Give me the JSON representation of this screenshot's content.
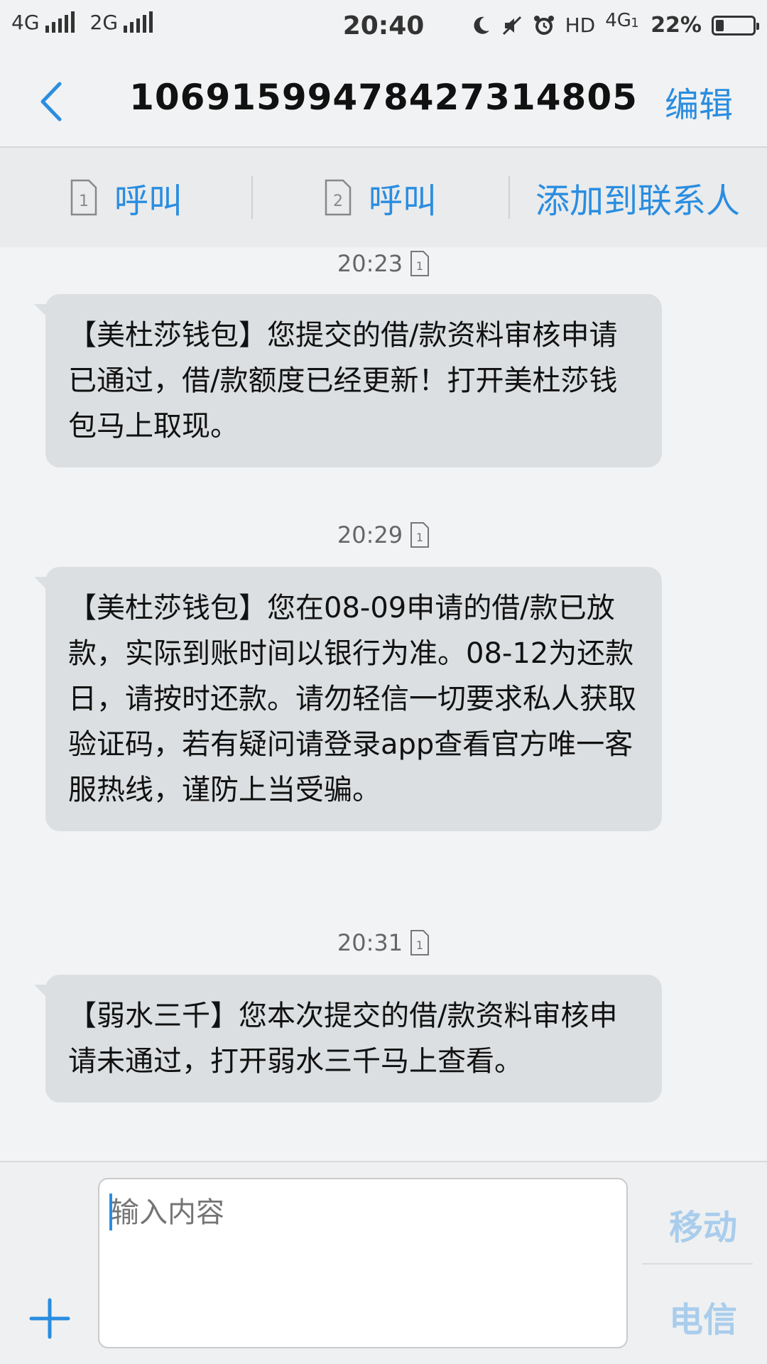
{
  "status_bar": {
    "network_1": "4G",
    "network_2": "2G",
    "time": "20:40",
    "hd_label": "HD",
    "net_type": "4G",
    "sim_index": "1",
    "battery_percent": "22%",
    "battery_level": 0.22
  },
  "header": {
    "title": "1069159947842731480​5",
    "edit_label": "编辑"
  },
  "actions": {
    "call_sim1_number": "1",
    "call_sim1_label": "呼叫",
    "call_sim2_number": "2",
    "call_sim2_label": "呼叫",
    "add_contact_label": "添加到联系人"
  },
  "messages": [
    {
      "time": "20:23",
      "sim": "1",
      "text": "【美杜莎钱包】您提交的借/款资料审核申请已通过，借/款额度已经更新！打开美杜莎钱包马上取现。"
    },
    {
      "time": "20:29",
      "sim": "1",
      "text": "【美杜莎钱包】您在08-09申请的借/款已放款，实际到账时间以银行为准。08-12为还款日，请按时还款。请勿轻信一切要求私人获取验证码，若有疑问请登录app查看官方唯一客服热线，谨防上当受骗。"
    },
    {
      "time": "20:31",
      "sim": "1",
      "text": "【弱水三千】您本次提交的借/款资料审核申请未通过，打开弱水三千马上查看。"
    }
  ],
  "composer": {
    "placeholder": "输入内容",
    "send_sim1_label": "移动",
    "send_sim2_label": "电信"
  },
  "colors": {
    "accent": "#2a8de0",
    "bubble": "#dcdfe1",
    "background": "#f2f3f4"
  },
  "icons": {
    "back": "chevron-left-icon",
    "sim_card": "sim-card-icon",
    "add": "plus-icon",
    "moon": "moon-icon",
    "mute": "vibrate-off-icon",
    "alarm": "alarm-icon"
  }
}
